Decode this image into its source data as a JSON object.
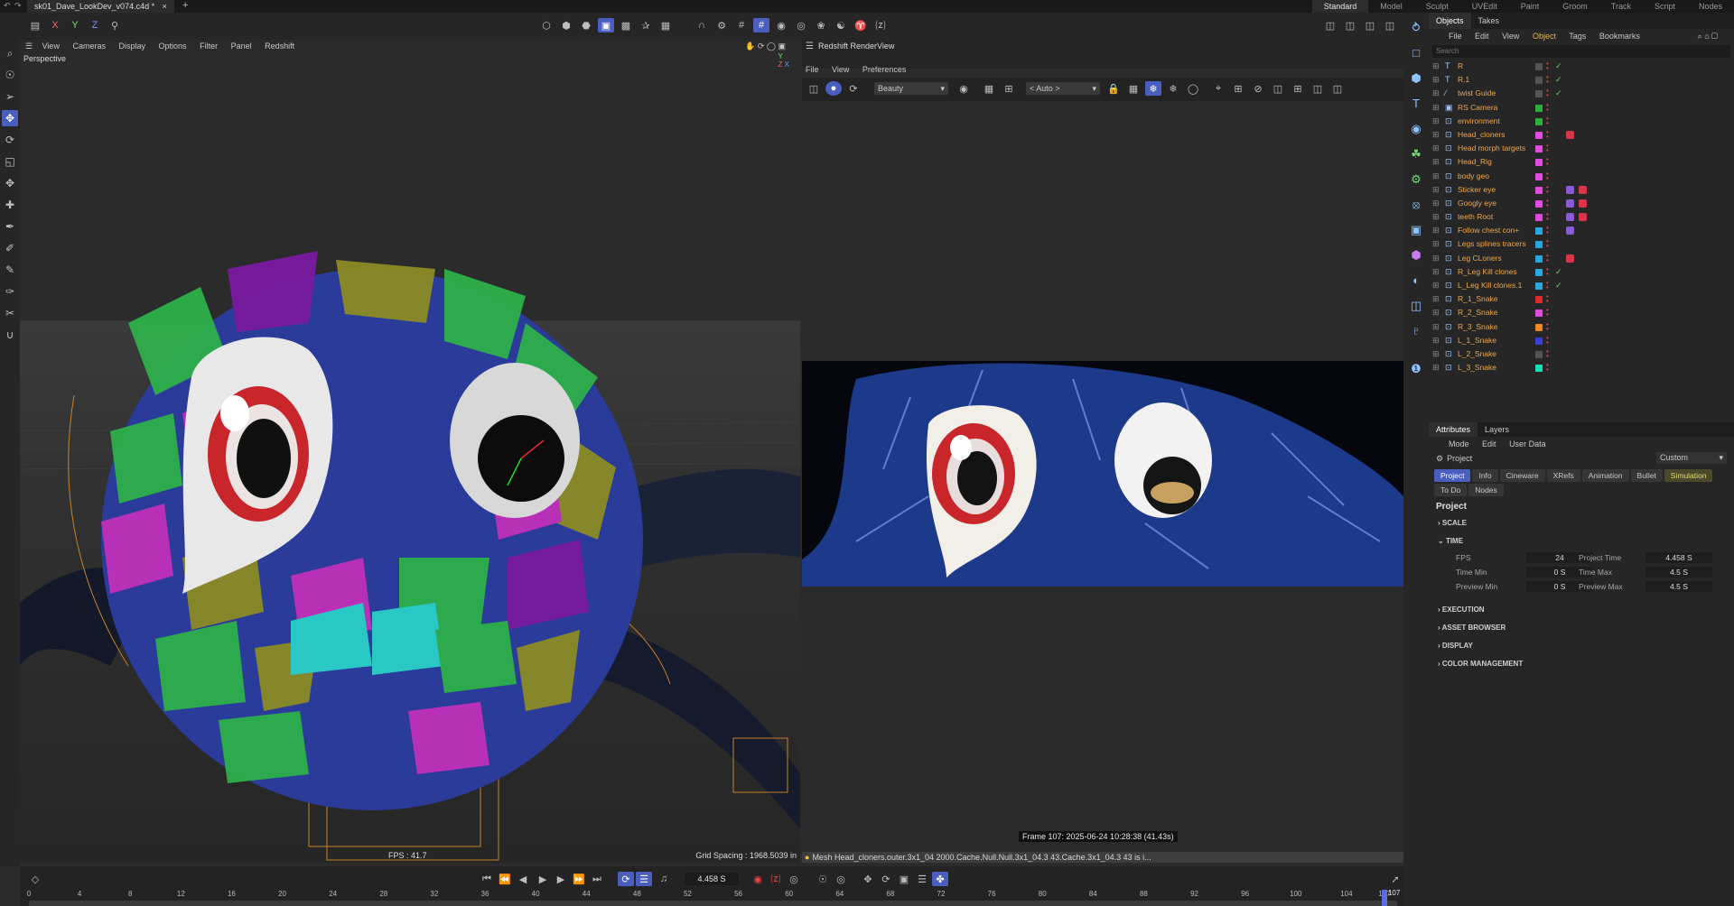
{
  "window": {
    "file_tab": "sk01_Dave_LookDev_v074.c4d *",
    "new_tab": "+",
    "axis_buttons": [
      "X",
      "Y",
      "Z"
    ],
    "layouts": [
      "Standard",
      "Model",
      "Sculpt",
      "UVEdit",
      "Paint",
      "Groom",
      "Track",
      "Script",
      "Nodes"
    ],
    "active_layout": "Standard"
  },
  "viewport": {
    "menu": [
      "View",
      "Cameras",
      "Display",
      "Options",
      "Filter",
      "Panel",
      "Redshift"
    ],
    "camera_label": "Perspective",
    "fps": "FPS : 41.7",
    "grid_spacing": "Grid Spacing : 1968.5039 in"
  },
  "renderview": {
    "title": "Redshift RenderView",
    "menu": [
      "File",
      "View",
      "Preferences"
    ],
    "aov": "Beauty",
    "camera": "< Auto >",
    "frame_info": "Frame  107:  2025-06-24  10:28:38  (41.43s)",
    "status_message": "Mesh Head_cloners.outer.3x1_04 2000.Cache.Null.Null.3x1_04.3 43.Cache.3x1_04.3 43 is i..."
  },
  "object_manager": {
    "tabs": [
      "Objects",
      "Takes"
    ],
    "menu": [
      "File",
      "Edit",
      "View",
      "Object",
      "Tags",
      "Bookmarks"
    ],
    "active_menu": "Object",
    "search_placeholder": "Search",
    "objects": [
      {
        "name": "R",
        "color": "#555555",
        "check": true,
        "icon": "text-icon"
      },
      {
        "name": "R.1",
        "color": "#555555",
        "check": true,
        "icon": "text-icon"
      },
      {
        "name": "twist Guide",
        "color": "#555555",
        "check": true,
        "icon": "spline-icon"
      },
      {
        "name": "RS Camera",
        "color": "#2eae3e",
        "check": false,
        "icon": "camera-icon"
      },
      {
        "name": "environment",
        "color": "#2eae3e",
        "check": false,
        "icon": "null-icon"
      },
      {
        "name": "Head_cloners",
        "color": "#e14be0",
        "check": false,
        "icon": "null-icon",
        "tag": true
      },
      {
        "name": "Head morph targets",
        "color": "#e14be0",
        "check": false,
        "icon": "null-icon"
      },
      {
        "name": "Head_Rig",
        "color": "#e14be0",
        "check": false,
        "icon": "null-icon"
      },
      {
        "name": "body geo",
        "color": "#e14be0",
        "check": false,
        "icon": "null-icon"
      },
      {
        "name": "Sticker eye",
        "color": "#e14be0",
        "check": false,
        "icon": "null-icon",
        "tag": true,
        "tagp": true
      },
      {
        "name": "Googly eye",
        "color": "#e14be0",
        "check": false,
        "icon": "null-icon",
        "tag": true,
        "tagp": true
      },
      {
        "name": "teeth Root",
        "color": "#e14be0",
        "check": false,
        "icon": "null-icon",
        "tag": true,
        "tagp": true
      },
      {
        "name": "Follow chest con+",
        "color": "#2aa9e0",
        "check": false,
        "icon": "null-icon",
        "tagp": true
      },
      {
        "name": "Legs splines tracers",
        "color": "#2aa9e0",
        "check": false,
        "icon": "null-icon"
      },
      {
        "name": "Leg CLoners",
        "color": "#2aa9e0",
        "check": false,
        "icon": "null-icon",
        "tag": true
      },
      {
        "name": "R_Leg Kill clones",
        "color": "#2aa9e0",
        "check": true,
        "icon": "null-icon"
      },
      {
        "name": "L_Leg Kill clones.1",
        "color": "#2aa9e0",
        "check": true,
        "icon": "null-icon"
      },
      {
        "name": "R_1_Snake",
        "color": "#e02828",
        "check": false,
        "icon": "null-icon"
      },
      {
        "name": "R_2_Snake",
        "color": "#e14be0",
        "check": false,
        "icon": "null-icon"
      },
      {
        "name": "R_3_Snake",
        "color": "#f08a1e",
        "check": false,
        "icon": "null-icon"
      },
      {
        "name": "L_1_Snake",
        "color": "#3a3ae0",
        "check": false,
        "icon": "null-icon"
      },
      {
        "name": "L_2_Snake",
        "color": "#555555",
        "check": false,
        "icon": "null-icon"
      },
      {
        "name": "L_3_Snake",
        "color": "#1ee0c0",
        "check": false,
        "icon": "null-icon"
      }
    ]
  },
  "attributes": {
    "tabs": [
      "Attributes",
      "Layers"
    ],
    "menu": [
      "Mode",
      "Edit",
      "User Data"
    ],
    "mode_label": "Project",
    "mode_value": "Custom",
    "project_tabs": [
      "Project",
      "Info",
      "Cineware",
      "XRefs",
      "Animation",
      "Bullet",
      "Simulation",
      "To Do",
      "Nodes"
    ],
    "active_tab": "Project",
    "heading": "Project",
    "sections": {
      "scale": "SCALE",
      "time": "TIME",
      "execution": "EXECUTION",
      "asset_browser": "ASSET BROWSER",
      "display": "DISPLAY",
      "color_management": "COLOR MANAGEMENT"
    },
    "time_fields": {
      "fps_label": "FPS",
      "fps": "24",
      "project_time_label": "Project Time",
      "project_time": "4.458 S",
      "time_min_label": "Time Min",
      "time_min": "0 S",
      "time_max_label": "Time Max",
      "time_max": "4.5 S",
      "preview_min_label": "Preview Min",
      "preview_min": "0 S",
      "preview_max_label": "Preview Max",
      "preview_max": "4.5 S"
    }
  },
  "timeline": {
    "current_time": "4.458 S",
    "ticks": [
      "0",
      "4",
      "8",
      "12",
      "16",
      "20",
      "24",
      "28",
      "32",
      "36",
      "40",
      "44",
      "48",
      "52",
      "56",
      "60",
      "64",
      "68",
      "72",
      "76",
      "80",
      "84",
      "88",
      "92",
      "96",
      "100",
      "104",
      "107"
    ],
    "current_frame": "107",
    "frame_min": 0,
    "frame_max": 108,
    "playhead_frame": 107
  },
  "colors": {
    "accent": "#4a5ec0",
    "object_name": "#f0a84a",
    "active_menu": "#f0b64a"
  }
}
